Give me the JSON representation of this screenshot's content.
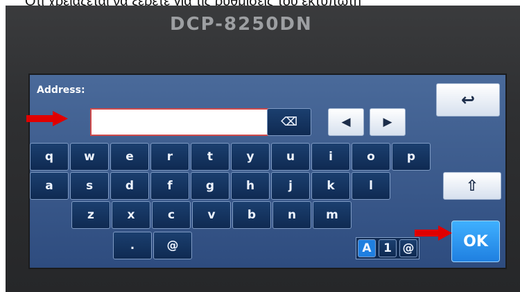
{
  "caption": "Ότι χρειάζεται να ξέρετε για τις ρυθμίσεις του εκτυπωτή",
  "device": {
    "model": "DCP-8250DN"
  },
  "screen": {
    "address_label": "Address:",
    "address_value": "",
    "backspace_label": "⌫",
    "nav_left_label": "◀",
    "nav_right_label": "▶",
    "back_label": "↩",
    "shift_label": "⇧",
    "ok_label": "OK",
    "row1": [
      "q",
      "w",
      "e",
      "r",
      "t",
      "y",
      "u",
      "i",
      "o",
      "p"
    ],
    "row2": [
      "a",
      "s",
      "d",
      "f",
      "g",
      "h",
      "j",
      "k",
      "l"
    ],
    "row3": [
      "z",
      "x",
      "c",
      "v",
      "b",
      "n",
      "m"
    ],
    "row4": [
      ".",
      "@"
    ],
    "mode": {
      "alpha": "A",
      "numeric": "1",
      "symbol": "@"
    }
  },
  "colors": {
    "screen_bg": "#2e4c7f",
    "key_bg": "#0f2a52",
    "ok_bg": "#1f7fe0",
    "annotation_arrow": "#e00000"
  }
}
